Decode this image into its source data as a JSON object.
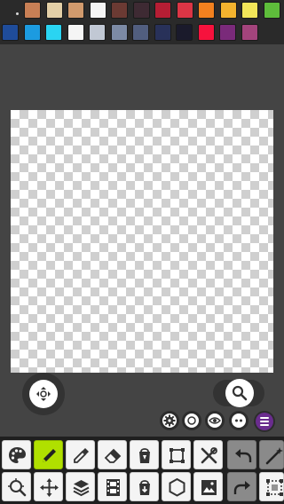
{
  "app": {
    "type": "pixel-art-editor"
  },
  "palette": {
    "current_color_icon": "current-color-dot",
    "row1": [
      "#c87f55",
      "#e3cfa7",
      "#d19a6d",
      "#f5f5f5",
      "#6b3a33",
      "#3e2a33",
      "#b51e34",
      "#dc3545",
      "#f3811f",
      "#f3b32e",
      "#f2e559",
      "#5ebd3b"
    ],
    "row2": [
      "#1f4c9a",
      "#1c9be0",
      "#2ad4f2",
      "#f5f5f5",
      "#c1c8d4",
      "#7c8aa5",
      "#515e7f",
      "#283159",
      "#1a1a2b",
      "#f6123d",
      "#7a2a7a",
      "#a3447c"
    ]
  },
  "controls": {
    "move_button_icon": "arrows-move-icon",
    "zoom_button_icon": "magnifier-icon",
    "mini_buttons": [
      "gear-icon",
      "circle-icon",
      "eye-icon",
      "dots-icon"
    ],
    "menu_button_icon": "menu-icon"
  },
  "toolbar": {
    "row1": [
      "palette-icon",
      "pencil-icon",
      "eyedropper-icon",
      "eraser-icon",
      "paint-bucket-icon",
      "selection-icon",
      "tools-icon",
      "undo-icon",
      "magic-wand-icon"
    ],
    "row2": [
      "zoom-tool-icon",
      "move-tool-icon",
      "layers-icon",
      "animation-icon",
      "save-icon",
      "shape-icon",
      "image-icon",
      "redo-icon",
      "crop-icon"
    ],
    "active_tool": "pencil-icon"
  }
}
